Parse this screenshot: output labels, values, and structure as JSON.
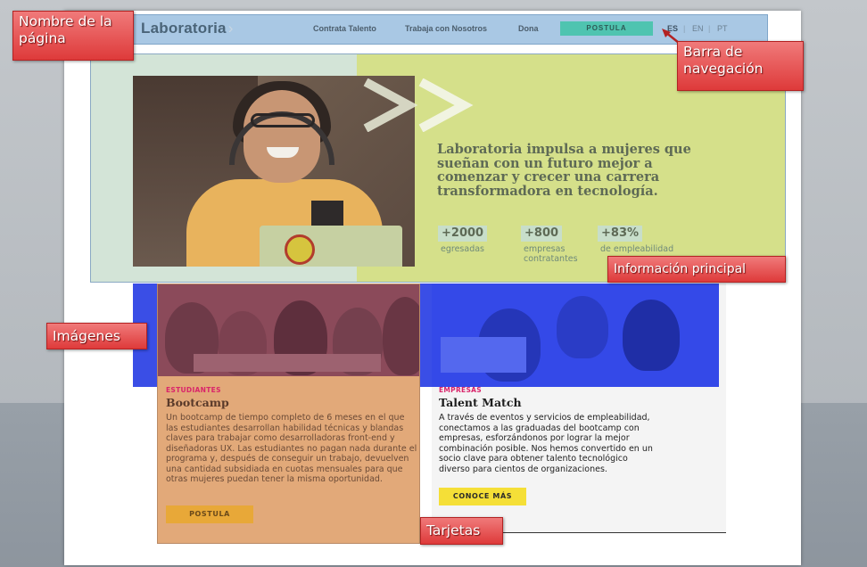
{
  "nav": {
    "brand": "Laboratoria",
    "brand_arrow": "›",
    "links": [
      "Contrata Talento",
      "Trabaja con Nosotros",
      "Dona"
    ],
    "postula": "POSTULA",
    "languages": [
      "ES",
      "EN",
      "PT"
    ],
    "lang_separator": "|"
  },
  "hero": {
    "heading": "Laboratoria impulsa a mujeres que sueñan con un futuro mejor a comenzar y crecer una carrera transformadora en tecnología.",
    "stats": [
      {
        "value": "+2000",
        "label": "egresadas"
      },
      {
        "value": "+800",
        "label": "empresas contratantes"
      },
      {
        "value": "+83%",
        "label": "de empleabilidad"
      }
    ]
  },
  "cards": [
    {
      "tag": "ESTUDIANTES",
      "title": "Bootcamp",
      "body": "Un bootcamp de tiempo completo de 6 meses en el que las estudiantes desarrollan habilidad técnicas y blandas claves para trabajar como desarrolladoras front-end y diseñadoras UX. Las estudiantes no pagan nada durante el programa y, después de conseguir un trabajo, devuelven una cantidad subsidiada en cuotas mensuales para que otras mujeres puedan tener la misma oportunidad.",
      "button": "POSTULA"
    },
    {
      "tag": "EMPRESAS",
      "title": "Talent Match",
      "body": "A través de eventos y servicios de empleabilidad, conectamos a las graduadas del bootcamp con empresas, esforzándonos por lograr la mejor combinación posible. Nos hemos convertido en un socio clave para obtener talento tecnológico diverso para cientos de organizaciones.",
      "button": "CONOCE MÁS"
    }
  ],
  "annotations": {
    "page_name": "Nombre de la página",
    "navbar": "Barra de navegación",
    "main_info": "Información principal",
    "images": "Imágenes",
    "cards": "Tarjetas"
  },
  "colors": {
    "annotation": "#de3a3a",
    "nav_bg": "#a9c8e4",
    "postula_button": "#4fc4b0",
    "hero_left": "#d3e4d7",
    "hero_right": "#d5e08a",
    "images_overlay": "#3a4ee6",
    "card_overlay": "#e2a979",
    "cta_yellow": "#f5df37",
    "tag_pink": "#d9246a"
  }
}
